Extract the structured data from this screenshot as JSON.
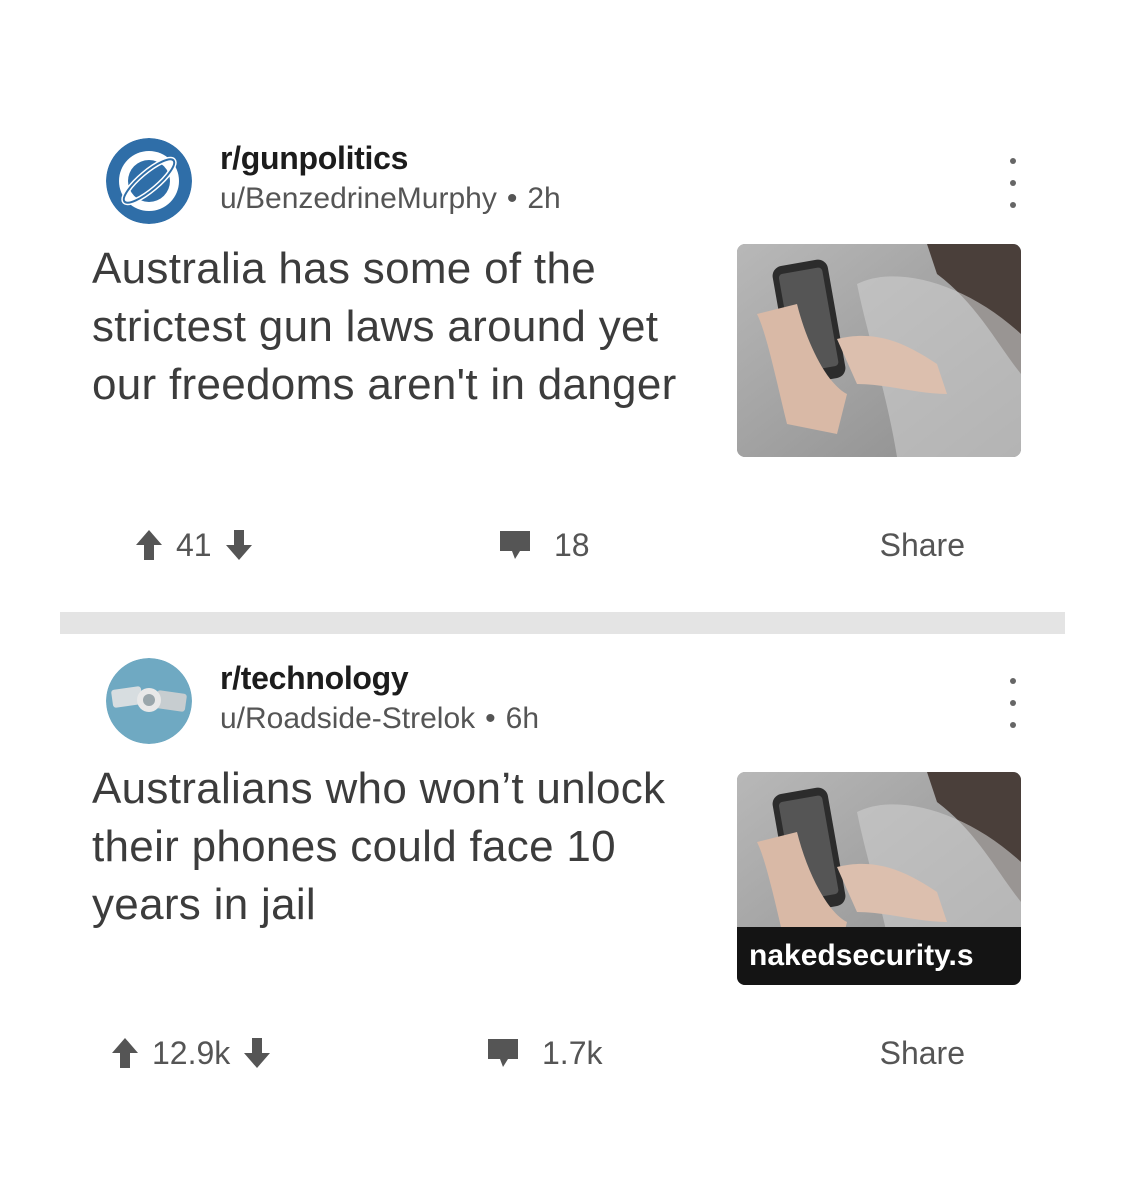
{
  "posts": [
    {
      "subreddit": "r/gunpolitics",
      "user": "u/BenzedrineMurphy",
      "age": "2h",
      "title": "Australia has some of the strictest gun laws around yet our freedoms aren't in danger",
      "thumbnail_domain": "",
      "upvotes": "41",
      "comments": "18",
      "share_label": "Share",
      "icon": "reddit-planet-icon"
    },
    {
      "subreddit": "r/technology",
      "user": "u/Roadside-Strelok",
      "age": "6h",
      "title": "Australians who won’t unlock their phones could face 10 years in jail",
      "thumbnail_domain": "nakedsecurity.s",
      "upvotes": "12.9k",
      "comments": "1.7k",
      "share_label": "Share",
      "icon": "handshake-icon"
    }
  ],
  "separator": "•",
  "colors": {
    "icon_blue": "#2f6ea8",
    "icon_teal": "#6fa9c2",
    "divider": "#e4e4e4",
    "meta_text": "#555555"
  }
}
